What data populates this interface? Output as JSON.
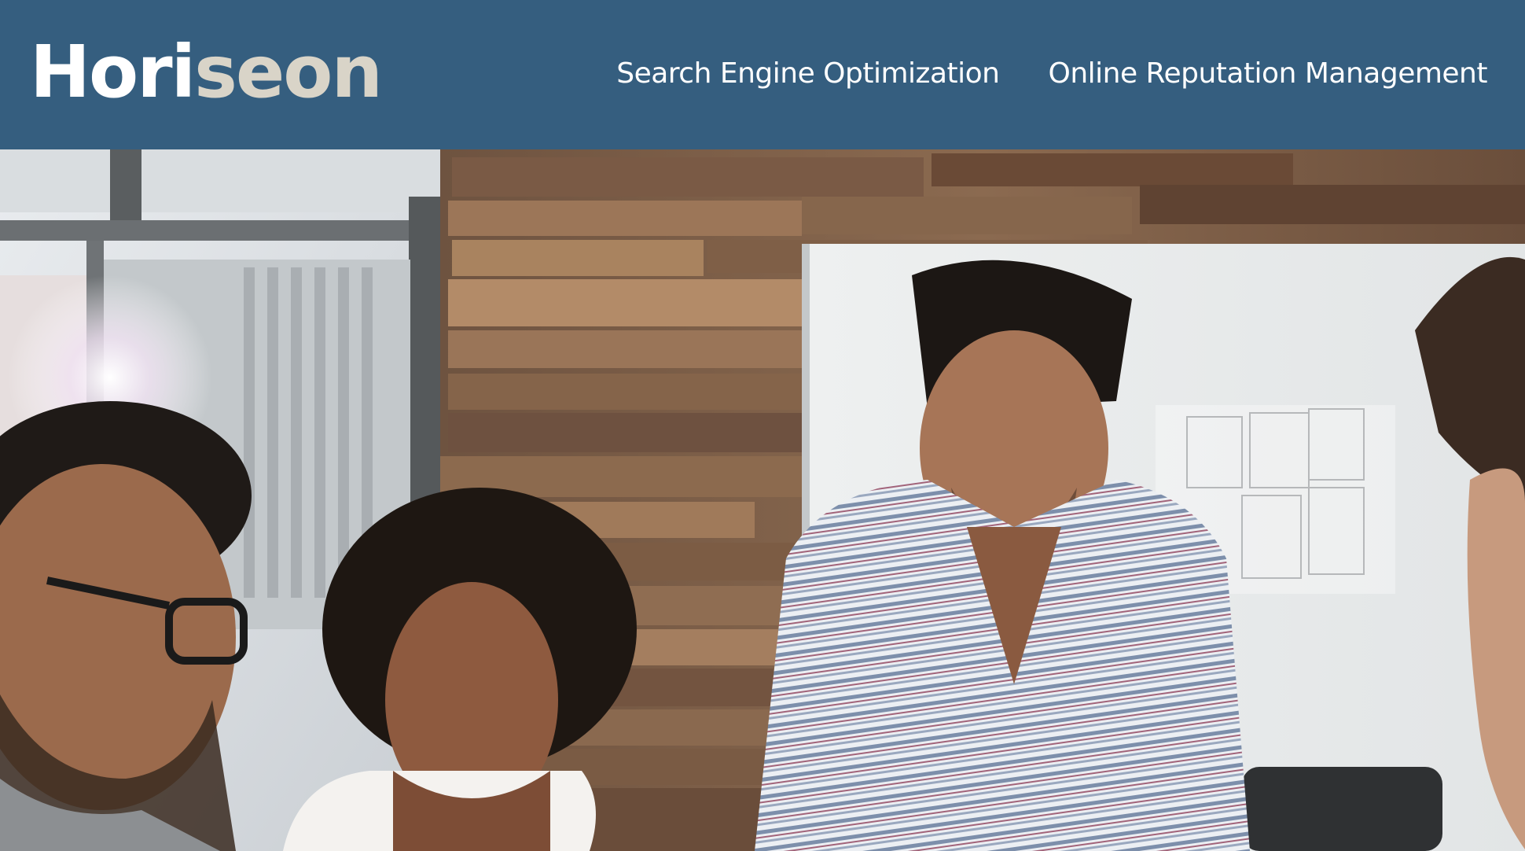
{
  "header": {
    "logo": {
      "part1": "Hori",
      "part2": "seon",
      "part3": ""
    },
    "nav": [
      {
        "label": "Search Engine Optimization"
      },
      {
        "label": "Online Reputation Management"
      }
    ]
  },
  "colors": {
    "header_bg": "#355e7f",
    "logo_main": "#ffffff",
    "logo_accent": "#d9d4c8"
  },
  "hero": {
    "image": "team-meeting-photo"
  }
}
